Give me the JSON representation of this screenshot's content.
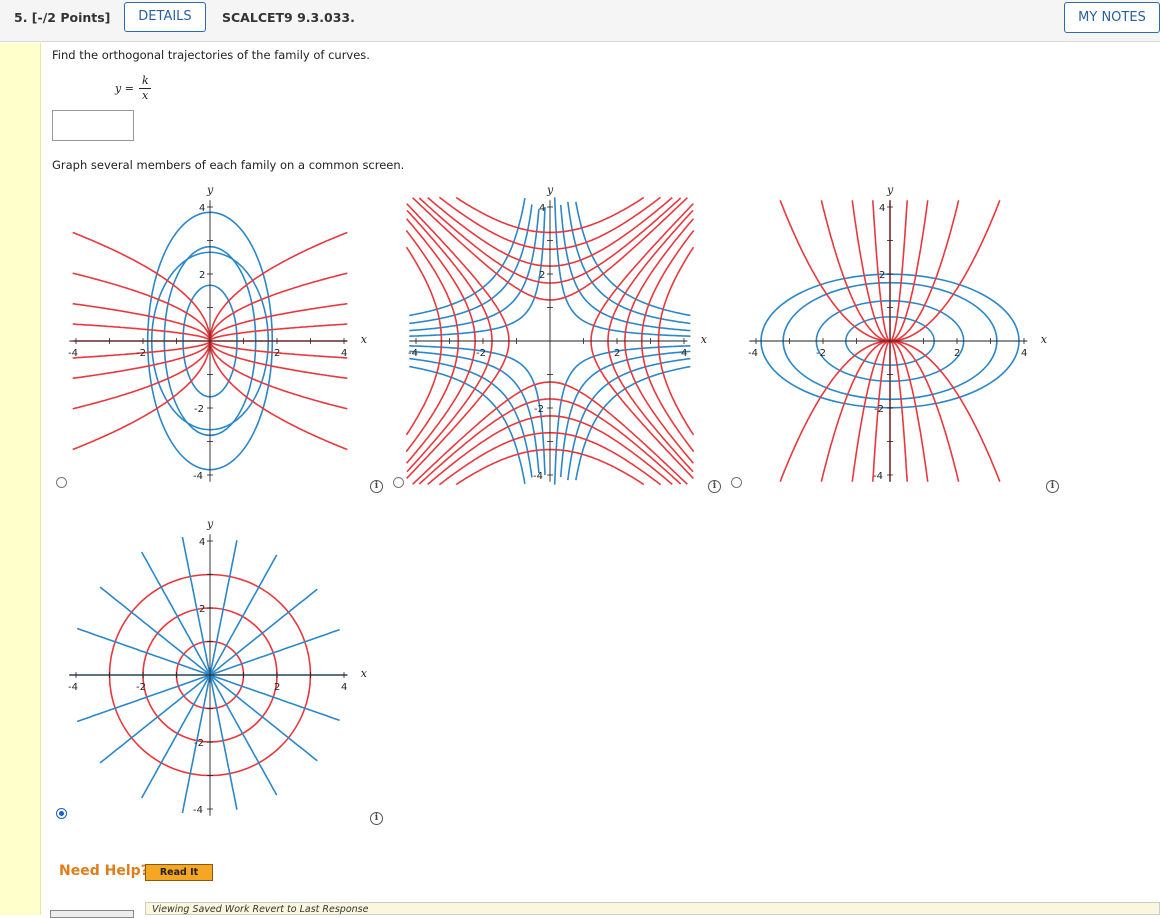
{
  "header": {
    "question_number": "5. [-/2 Points]",
    "details_label": "DETAILS",
    "question_id": "SCALCET9 9.3.033.",
    "my_notes_label": "MY NOTES"
  },
  "question": {
    "prompt": "Find the orthogonal trajectories of the family of curves.",
    "formula_lhs": "y =",
    "formula_numerator": "k",
    "formula_denominator": "x",
    "answer_value": "",
    "graph_prompt": "Graph several members of each family on a common screen."
  },
  "graphs": {
    "axis_x_label": "x",
    "axis_y_label": "y",
    "tick_labels": {
      "neg4": "-4",
      "neg2": "-2",
      "pos2": "2",
      "pos4": "4",
      "y4": "4",
      "y2": "2",
      "yneg2": "-2",
      "yneg4": "-4"
    },
    "options": [
      {
        "id": "A",
        "selected": false,
        "description": "ellipses elongated vertically with curves through origin"
      },
      {
        "id": "B",
        "selected": false,
        "description": "two families of hyperbolas"
      },
      {
        "id": "C",
        "selected": false,
        "description": "ellipses elongated horizontally with curves through origin"
      },
      {
        "id": "D",
        "selected": true,
        "description": "concentric circles with lines through origin"
      }
    ],
    "colors": {
      "red": "#e8383d",
      "blue": "#2b87c8"
    }
  },
  "help": {
    "need_help_label": "Need Help?",
    "read_it_label": "Read It"
  },
  "footer": {
    "viewing_text": "Viewing Saved Work Revert to Last Response"
  }
}
